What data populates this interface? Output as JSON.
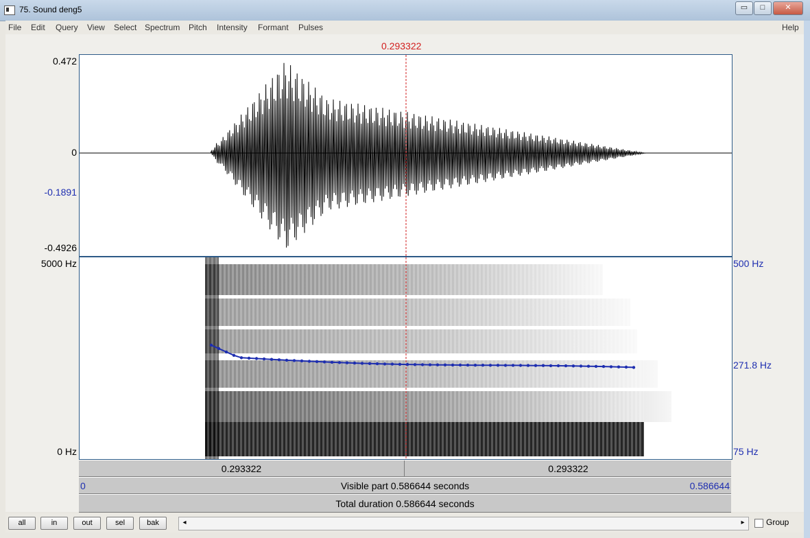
{
  "window": {
    "title": "75. Sound deng5",
    "minimize": "▭",
    "maximize": "□",
    "close": "✕"
  },
  "menu": [
    "File",
    "Edit",
    "Query",
    "View",
    "Select",
    "Spectrum",
    "Pitch",
    "Intensity",
    "Formant",
    "Pulses"
  ],
  "help": "Help",
  "cursor_time": "0.293322",
  "waveform": {
    "y_max": "0.472",
    "y_zero": "0",
    "y_cursor": "-0.1891",
    "y_min": "-0.4926"
  },
  "spectrogram": {
    "freq_top": "5000 Hz",
    "freq_bottom": "0 Hz",
    "pitch_top": "500 Hz",
    "pitch_mid": "271.8 Hz",
    "pitch_bottom": "75 Hz"
  },
  "bars": {
    "left_segment": "0.293322",
    "right_segment": "0.293322",
    "visible_start": "0",
    "visible_label": "Visible part 0.586644 seconds",
    "visible_end": "0.586644",
    "total_label": "Total duration 0.586644 seconds"
  },
  "buttons": [
    "all",
    "in",
    "out",
    "sel",
    "bak"
  ],
  "scroll_left": "◂",
  "scroll_right": "▸",
  "group_label": "Group",
  "colors": {
    "cursor": "#d21d1d",
    "pitch": "#1e2eb0",
    "axis_blue": "#1e2eb0"
  }
}
